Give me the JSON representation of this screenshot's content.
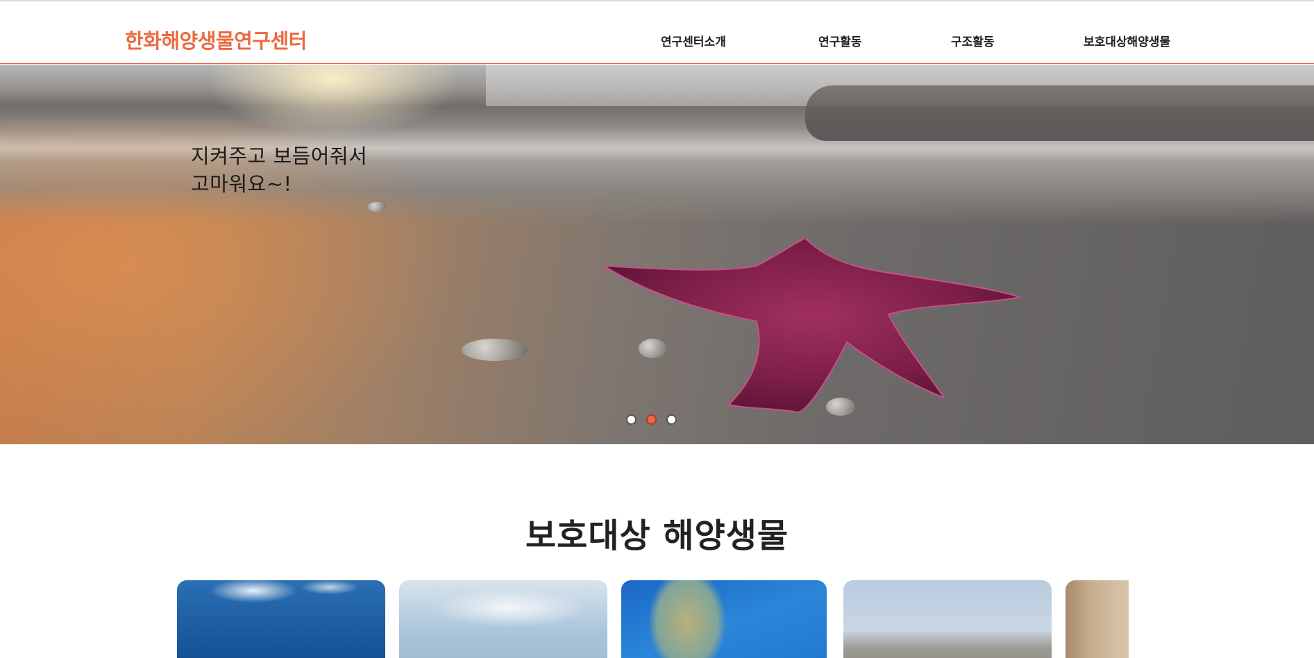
{
  "header": {
    "logo": "한화해양생물연구센터",
    "nav": [
      "연구센터소개",
      "연구활동",
      "구조활동",
      "보호대상해양생물"
    ]
  },
  "hero": {
    "caption_line1": "지켜주고 보듬어줘서",
    "caption_line2": "고마워요~!",
    "slides": 3,
    "active_slide": 2
  },
  "section": {
    "title": "보호대상 해양생물"
  },
  "colors": {
    "accent": "#ec6a3f",
    "text": "#222222"
  }
}
